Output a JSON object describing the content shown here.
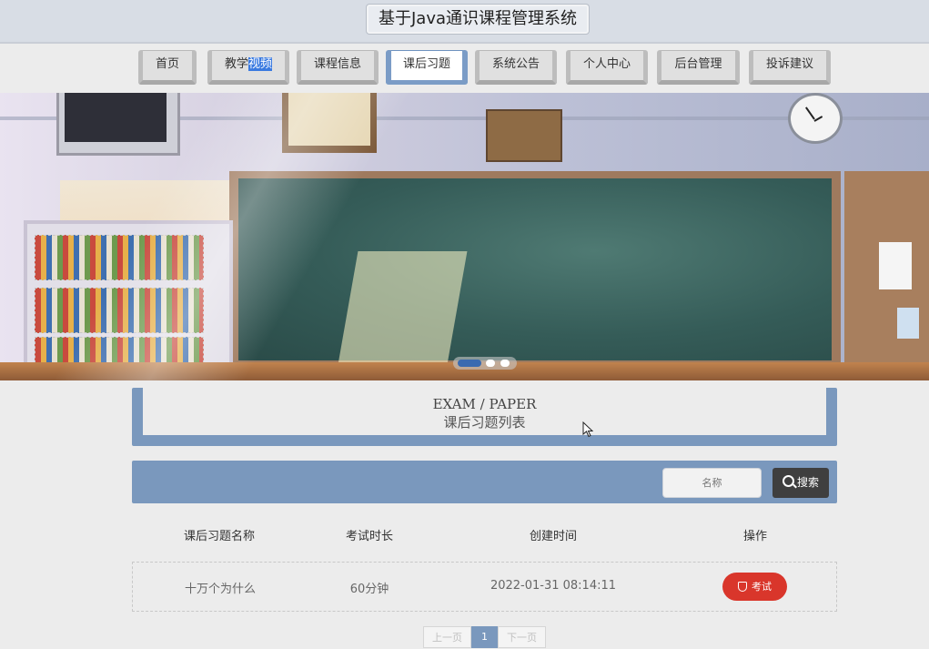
{
  "header": {
    "title": "基于Java通识课程管理系统"
  },
  "nav": {
    "items": [
      {
        "label": "首页"
      },
      {
        "label_a": "教学",
        "label_b": "视频"
      },
      {
        "label": "课程信息"
      },
      {
        "label": "课后习题"
      },
      {
        "label": "系统公告"
      },
      {
        "label": "个人中心"
      },
      {
        "label": "后台管理"
      },
      {
        "label": "投诉建议"
      }
    ],
    "active": "课后习题"
  },
  "section": {
    "title_en": "EXAM / PAPER",
    "title_cn": "课后习题列表"
  },
  "search": {
    "placeholder": "名称",
    "button_label": "搜索"
  },
  "table": {
    "headers": [
      "课后习题名称",
      "考试时长",
      "创建时间",
      "操作"
    ],
    "rows": [
      {
        "name": "十万个为什么",
        "duration": "60分钟",
        "created": "2022-01-31 08:14:11",
        "action": "考试"
      }
    ]
  },
  "pagination": {
    "prev": "上一页",
    "current": "1",
    "next": "下一页"
  },
  "colors": {
    "accent": "#7a98bd",
    "exam_button": "#d9362b",
    "search_button": "#3f3f3f"
  }
}
